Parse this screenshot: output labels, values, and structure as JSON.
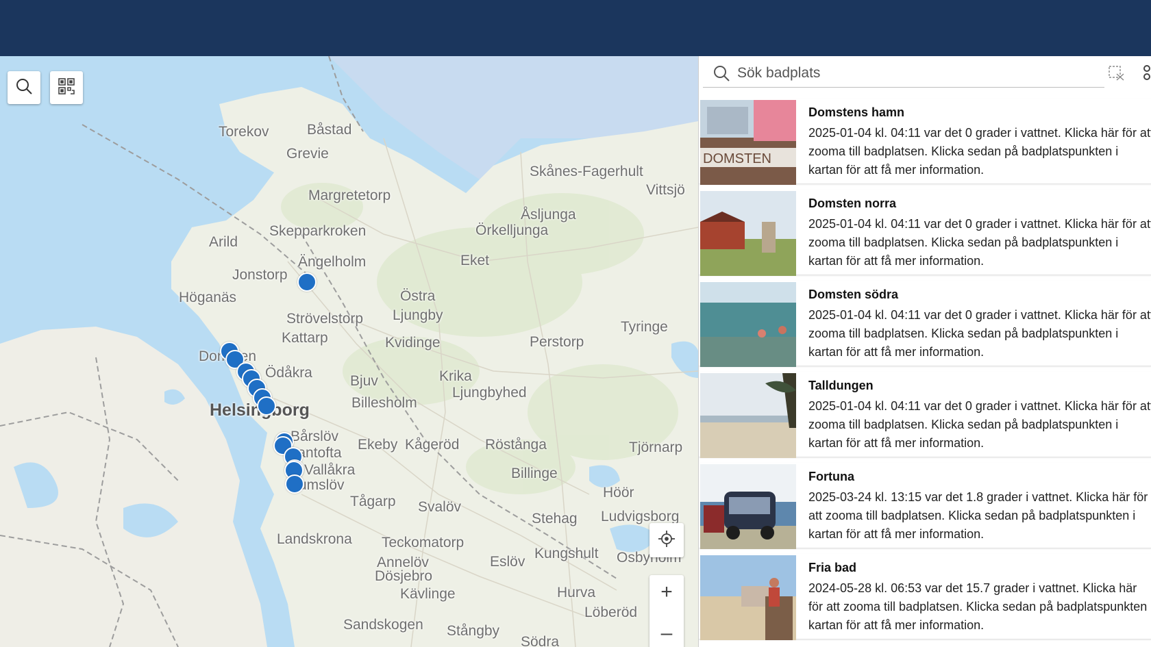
{
  "map": {
    "tools": {
      "search_icon": "search-icon",
      "qr_icon": "qr-grid-icon"
    },
    "controls": {
      "locate_icon": "crosshair-icon",
      "zoom_in": "+",
      "zoom_out": "–"
    },
    "labels": [
      "Torekov",
      "Båstad",
      "Grevie",
      "Margretetorp",
      "Skånes-Fagerhult",
      "Vittsjö",
      "Skepparkroken",
      "Arild",
      "Åsljunga",
      "Örkelljunga",
      "Ängelholm",
      "Jonstorp",
      "Eket",
      "Höganäs",
      "Östra",
      "Ljungby",
      "Strövelstorp",
      "Tyringe",
      "Kattarp",
      "Kvidinge",
      "Perstorp",
      "Domsten",
      "Ödåkra",
      "Bjuv",
      "Krika",
      "Ljungbyhed",
      "Billesholm",
      "Helsingborg",
      "Bårslöv",
      "Gantofta",
      "Ekeby",
      "Kågeröd",
      "Röstånga",
      "Tjörnarp",
      "Vallåkra",
      "Glumslöv",
      "Billinge",
      "Höör",
      "Tågarp",
      "Svalöv",
      "Stehag",
      "Ludvigsborg",
      "Landskrona",
      "Teckomatorp",
      "Annelöv",
      "Eslöv",
      "Kungshult",
      "Osbynolm",
      "Dösjebro",
      "Kävlinge",
      "Hurva",
      "Löberöd",
      "Sandskogen",
      "Stångby",
      "Södra"
    ],
    "colors": {
      "water": "#b9dcf3",
      "land": "#f1efe8",
      "marker": "#1f6fc5"
    }
  },
  "search": {
    "placeholder": "Sök badplats",
    "clear_icon": "clear-selection-icon",
    "more_icon": "more-icon"
  },
  "list": [
    {
      "title": "Domstens hamn",
      "desc": "2025-01-04 kl. 04:11 var det 0  grader i vattnet. Klicka här för att zooma till badplatsen. Klicka sedan på badplatspunkten i kartan för att få mer information."
    },
    {
      "title": "Domsten norra",
      "desc": "2025-01-04 kl. 04:11 var det 0  grader i vattnet. Klicka här för att zooma till badplatsen. Klicka sedan på badplatspunkten i kartan för att få mer information."
    },
    {
      "title": "Domsten södra",
      "desc": "2025-01-04 kl. 04:11 var det 0  grader i vattnet. Klicka här för att zooma till badplatsen. Klicka sedan på badplatspunkten i kartan för att få mer information."
    },
    {
      "title": "Talldungen",
      "desc": "2025-01-04 kl. 04:11 var det 0  grader i vattnet. Klicka här för att zooma till badplatsen. Klicka sedan på badplatspunkten i kartan för att få mer information."
    },
    {
      "title": "Fortuna",
      "desc": "2025-03-24 kl. 13:15 var det 1.8  grader i vattnet. Klicka här för att zooma till badplatsen. Klicka sedan på badplatspunkten i kartan för att få mer information."
    },
    {
      "title": "Fria bad",
      "desc": "2024-05-28 kl. 06:53 var det 15.7  grader i vattnet. Klicka här för att zooma till badplatsen. Klicka sedan på badplatspunkten i kartan för att få mer information."
    }
  ]
}
